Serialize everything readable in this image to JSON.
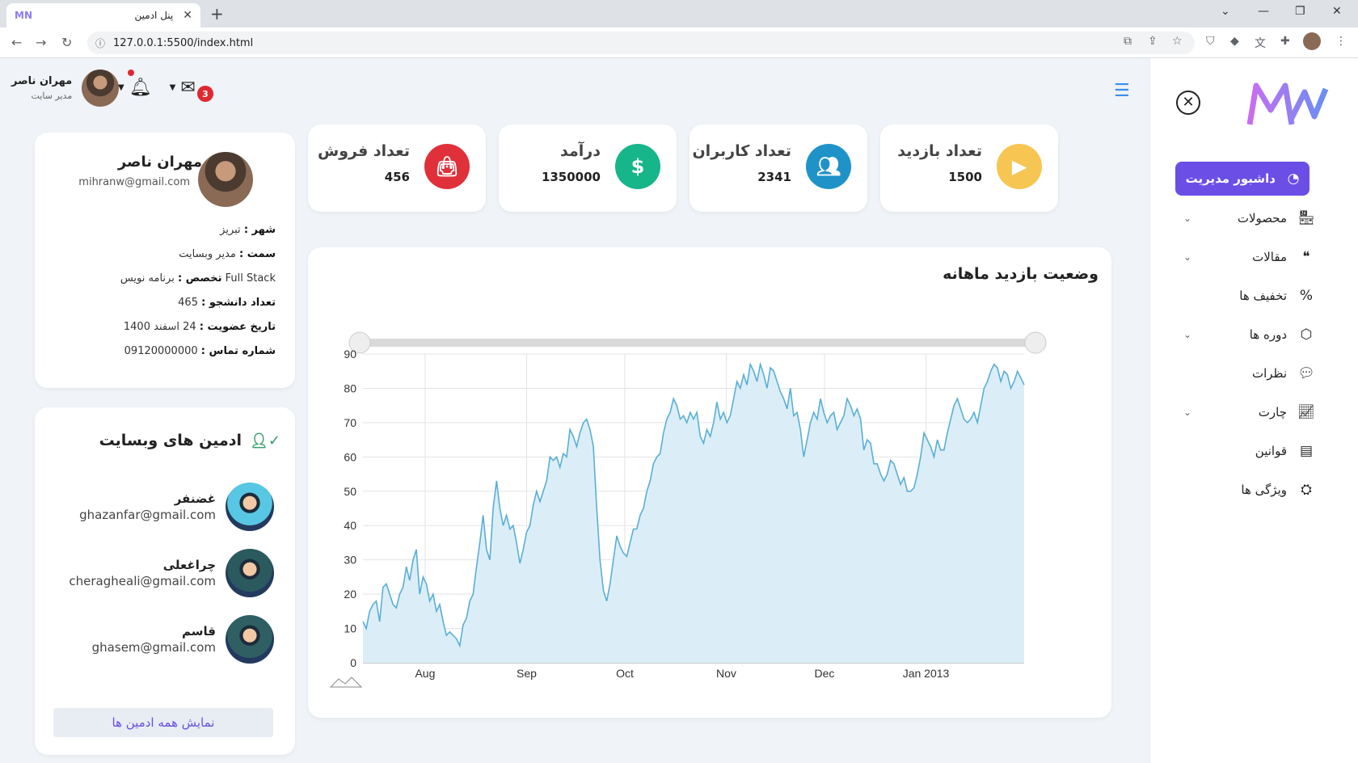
{
  "browser": {
    "tab_title": "پنل ادمین",
    "tab_favicon": "MN",
    "new_tab": "+",
    "url": "127.0.0.1:5500/index.html"
  },
  "header": {
    "user_name": "مهران ناصر",
    "user_role": "مدیر سایت",
    "mail_badge": "3"
  },
  "sidebar": {
    "logo": "MN",
    "items": [
      {
        "label": "داشبور مدیریت",
        "icon": "dashboard-icon",
        "active": true,
        "has_submenu": false
      },
      {
        "label": "محصولات",
        "icon": "store-icon",
        "active": false,
        "has_submenu": true
      },
      {
        "label": "مقالات",
        "icon": "quote-icon",
        "active": false,
        "has_submenu": true
      },
      {
        "label": "تخفیف ها",
        "icon": "percent-icon",
        "active": false,
        "has_submenu": false
      },
      {
        "label": "دوره ها",
        "icon": "box-icon",
        "active": false,
        "has_submenu": true
      },
      {
        "label": "نظرات",
        "icon": "comment-icon",
        "active": false,
        "has_submenu": false
      },
      {
        "label": "چارت",
        "icon": "chart-icon",
        "active": false,
        "has_submenu": true
      },
      {
        "label": "قوانین",
        "icon": "document-icon",
        "active": false,
        "has_submenu": false
      },
      {
        "label": "ویژگی ها",
        "icon": "lifebuoy-icon",
        "active": false,
        "has_submenu": false
      }
    ]
  },
  "stats": [
    {
      "label": "تعداد بازدید",
      "value": "1500",
      "icon": "play-icon",
      "color": "#f7c552"
    },
    {
      "label": "تعداد کاربران",
      "value": "2341",
      "icon": "users-icon",
      "color": "#1f93c8"
    },
    {
      "label": "درآمد",
      "value": "1350000",
      "icon": "dollar-icon",
      "color": "#16b58a"
    },
    {
      "label": "تعداد فروش",
      "value": "456",
      "icon": "bag-icon",
      "color": "#e0303a"
    }
  ],
  "profile": {
    "name": "مهران ناصر",
    "email": "mihranw@gmail.com",
    "fields": [
      {
        "k": "شهر :",
        "v": "تبریز"
      },
      {
        "k": "سمت :",
        "v": "مدیر وبسایت"
      },
      {
        "k": "تخصص :",
        "v": "برنامه نویس Full Stack"
      },
      {
        "k": "تعداد دانشجو :",
        "v": "465"
      },
      {
        "k": "تاریخ عضویت :",
        "v": "24 اسفند 1400"
      },
      {
        "k": "شماره تماس :",
        "v": "09120000000"
      }
    ]
  },
  "admins": {
    "title": "ادمین های وبسایت",
    "list": [
      {
        "name": "غضنفر",
        "email": "ghazanfar@gmail.com",
        "color": "#57c7e3"
      },
      {
        "name": "چراغعلی",
        "email": "cheragheali@gmail.com",
        "color": "#2a5a5e"
      },
      {
        "name": "قاسم",
        "email": "ghasem@gmail.com",
        "color": "#2f5f63"
      }
    ],
    "show_all": "نمایش همه ادمین ها"
  },
  "chart_data": {
    "type": "area",
    "title": "وضعیت بازدید ماهانه",
    "xlabel": "",
    "ylabel": "",
    "ylim": [
      0,
      90
    ],
    "yticks": [
      0,
      10,
      20,
      30,
      40,
      50,
      60,
      70,
      80,
      90
    ],
    "x_tick_labels": [
      "Aug",
      "Sep",
      "Oct",
      "Nov",
      "Dec",
      "Jan 2013"
    ],
    "grid": true,
    "legend": "none",
    "has_range_slider": true,
    "color": "#5aaed6",
    "x_start": "2012-07-13",
    "x_end": "2013-01-31",
    "values": [
      12,
      10,
      15,
      17,
      18,
      12,
      22,
      23,
      20,
      17,
      16,
      20,
      22,
      28,
      24,
      30,
      33,
      20,
      25,
      23,
      18,
      20,
      15,
      17,
      12,
      8,
      9,
      8,
      7,
      5,
      11,
      13,
      18,
      20,
      28,
      35,
      43,
      33,
      30,
      45,
      53,
      45,
      40,
      43,
      39,
      40,
      35,
      29,
      33,
      38,
      40,
      46,
      50,
      47,
      50,
      53,
      60,
      59,
      60,
      57,
      61,
      60,
      68,
      66,
      63,
      67,
      70,
      71,
      68,
      63,
      45,
      30,
      21,
      18,
      23,
      30,
      37,
      34,
      32,
      31,
      35,
      39,
      39,
      43,
      45,
      50,
      53,
      58,
      60,
      61,
      67,
      71,
      73,
      77,
      75,
      71,
      72,
      70,
      73,
      71,
      73,
      66,
      64,
      68,
      66,
      70,
      76,
      71,
      73,
      70,
      72,
      77,
      82,
      80,
      84,
      81,
      87,
      85,
      82,
      87,
      84,
      80,
      86,
      85,
      82,
      79,
      77,
      74,
      80,
      72,
      73,
      68,
      60,
      65,
      70,
      73,
      71,
      77,
      73,
      70,
      72,
      73,
      68,
      70,
      72,
      77,
      75,
      72,
      74,
      71,
      62,
      65,
      64,
      58,
      58,
      55,
      53,
      55,
      59,
      58,
      55,
      52,
      54,
      50,
      50,
      51,
      55,
      60,
      67,
      65,
      63,
      60,
      65,
      62,
      62,
      67,
      71,
      75,
      77,
      74,
      71,
      70,
      71,
      73,
      70,
      75,
      80,
      82,
      85,
      87,
      86,
      82,
      85,
      84,
      80,
      82,
      85,
      83,
      81
    ]
  }
}
